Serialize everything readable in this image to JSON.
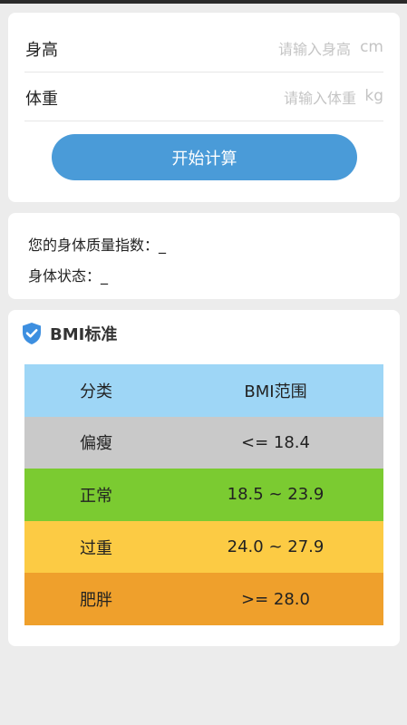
{
  "inputs": {
    "height": {
      "label": "身高",
      "placeholder": "请输入身高",
      "unit": "cm",
      "value": ""
    },
    "weight": {
      "label": "体重",
      "placeholder": "请输入体重",
      "unit": "kg",
      "value": ""
    },
    "calculate_button": "开始计算"
  },
  "result": {
    "bmi_label": "您的身体质量指数：",
    "bmi_value": "_",
    "status_label": "身体状态：",
    "status_value": "_"
  },
  "standard": {
    "icon": "shield-check-icon",
    "title": "BMI标准",
    "header": {
      "category": "分类",
      "range": "BMI范围",
      "color": "#9ed6f6"
    },
    "rows": [
      {
        "category": "偏瘦",
        "range": "<= 18.4",
        "color": "#c9c9c9"
      },
      {
        "category": "正常",
        "range": "18.5 ~ 23.9",
        "color": "#7bcb31"
      },
      {
        "category": "过重",
        "range": "24.0 ~ 27.9",
        "color": "#fccb44"
      },
      {
        "category": "肥胖",
        "range": ">= 28.0",
        "color": "#efa02c"
      }
    ]
  },
  "colors": {
    "accent": "#4a9bd8",
    "background": "#ececec",
    "card": "#ffffff"
  }
}
